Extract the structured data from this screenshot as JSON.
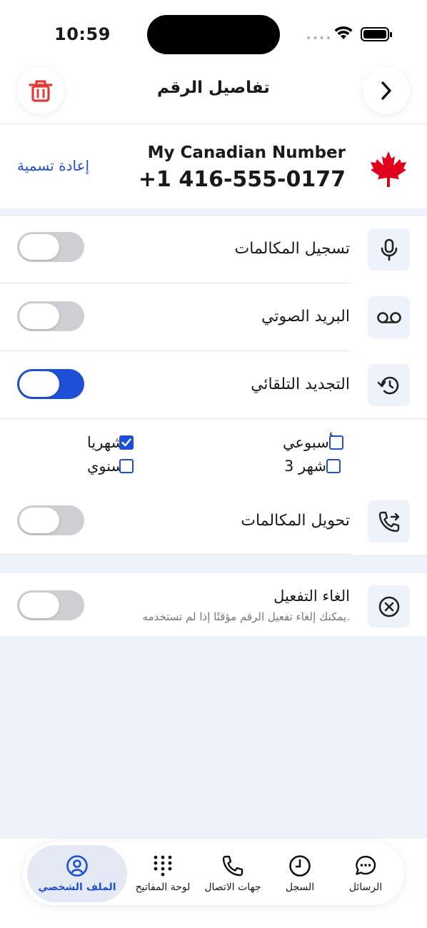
{
  "status_bar": {
    "time": "10:59"
  },
  "header": {
    "title": "تفاصيل الرقم",
    "back_icon": "chevron-right-icon",
    "delete_icon": "trash-icon"
  },
  "number": {
    "label": "My Canadian Number",
    "phone": "+1 416-555-0177",
    "rename_label": "إعادة تسمية",
    "flag_icon": "canada-flag-icon"
  },
  "settings": {
    "call_recording": {
      "label": "تسجيل المكالمات",
      "enabled": false
    },
    "voicemail": {
      "label": "البريد الصوتي",
      "enabled": false
    },
    "auto_renew": {
      "label": "التجديد التلقائي",
      "enabled": true,
      "options": [
        {
          "label": "شهريا",
          "checked": true
        },
        {
          "label": "أسبوعي",
          "checked": false
        },
        {
          "label": "سنوي",
          "checked": false
        },
        {
          "label": "3 اشهر",
          "checked": false
        }
      ]
    },
    "call_forwarding": {
      "label": "تحويل المكالمات",
      "enabled": false
    }
  },
  "deactivate": {
    "title": "الغاء التفعيل",
    "subtitle": "يمكنك إلغاء تفعيل الرقم مؤقتًا إذا لم تستخدمه.",
    "enabled": false
  },
  "nav": {
    "items": [
      {
        "label": "الملف الشخصي",
        "icon": "profile-icon",
        "active": true
      },
      {
        "label": "لوحة المفاتيح",
        "icon": "keypad-icon",
        "active": false
      },
      {
        "label": "جهات الاتصال",
        "icon": "phone-icon",
        "active": false
      },
      {
        "label": "السجل",
        "icon": "clock-icon",
        "active": false
      },
      {
        "label": "الرسائل",
        "icon": "chat-icon",
        "active": false
      }
    ]
  },
  "colors": {
    "accent": "#1f4fd6",
    "delete": "#e53935",
    "background": "#EEF3FB"
  }
}
